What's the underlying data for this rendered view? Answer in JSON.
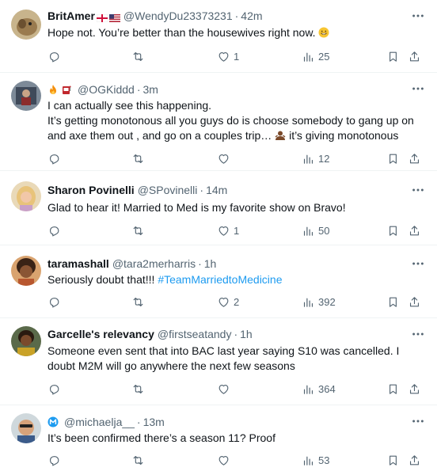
{
  "tweets": [
    {
      "name": "BritAmer",
      "handle": "@WendyDu23373231",
      "time": "42m",
      "text": "Hope not. You’re better than the housewives right now.",
      "replies": "",
      "retweets": "",
      "likes": "1",
      "views": "25"
    },
    {
      "name": "",
      "handle": "@OGKiddd",
      "time": "3m",
      "lines": [
        "I can actually see this happening.",
        "It’s getting monotonous all you guys do is choose somebody to gang up on",
        "and axe them out , and go on a couples trip…",
        "it’s giving  monotonous"
      ],
      "replies": "",
      "retweets": "",
      "likes": "",
      "views": "12"
    },
    {
      "name": "Sharon Povinelli",
      "handle": "@SPovinelli",
      "time": "14m",
      "text": "Glad to hear it! Married to Med is my favorite show on Bravo!",
      "replies": "",
      "retweets": "",
      "likes": "1",
      "views": "50"
    },
    {
      "name": "taramashall",
      "handle": "@tara2merharris",
      "time": "1h",
      "text": "Seriously doubt that!!! ",
      "hashtag": "#TeamMarriedtoMedicine",
      "replies": "",
      "retweets": "",
      "likes": "2",
      "views": "392"
    },
    {
      "name": "Garcelle's relevancy",
      "handle": "@firstseatandy",
      "time": "1h",
      "lines": [
        "Someone even sent that into BAC last year saying S10 was cancelled. I",
        "doubt M2M will go anywhere the next few seasons"
      ],
      "replies": "",
      "retweets": "",
      "likes": "",
      "views": "364"
    },
    {
      "name": "",
      "handle": "@michaelja__",
      "time": "13m",
      "text": "It’s been confirmed there’s a season 11? Proof",
      "replies": "",
      "retweets": "",
      "likes": "",
      "views": "53"
    }
  ],
  "separator": "·",
  "colors": {
    "text": "#0f1419",
    "secondary": "#536471",
    "link": "#1d9bf0",
    "divider": "#eff3f4"
  }
}
